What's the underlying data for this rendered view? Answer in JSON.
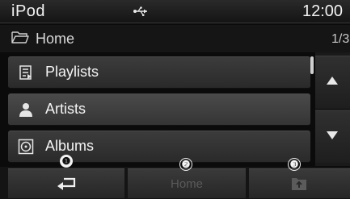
{
  "status": {
    "app_title": "iPod",
    "clock": "12:00",
    "usb_icon": "usb-icon"
  },
  "path": {
    "label": "Home",
    "page": "1/3",
    "folder_icon": "folder-open-icon"
  },
  "list": {
    "items": [
      {
        "label": "Playlists",
        "icon": "playlist-icon"
      },
      {
        "label": "Artists",
        "icon": "artist-icon"
      },
      {
        "label": "Albums",
        "icon": "album-icon"
      }
    ]
  },
  "scroll": {
    "up_icon": "triangle-up-icon",
    "down_icon": "triangle-down-icon"
  },
  "bottom": {
    "back_icon": "back-arrow-icon",
    "home_label": "Home",
    "upfolder_icon": "folder-up-icon"
  },
  "callouts": [
    "❶",
    "❷",
    "❸"
  ],
  "colors": {
    "background": "#0b0b0b",
    "item_bg": "#333333",
    "text": "#f4f4f4",
    "disabled_text": "#5a5a5a"
  }
}
